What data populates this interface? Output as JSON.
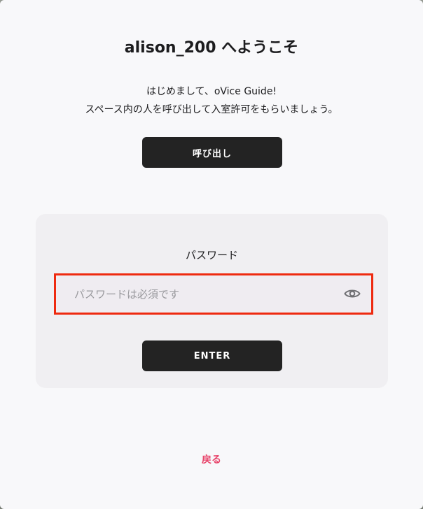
{
  "dialog": {
    "title": "alison_200 へようこそ",
    "description_line1": "はじめまして、oVice Guide!",
    "description_line2": "スペース内の人を呼び出して入室許可をもらいましょう。",
    "call_button_label": "呼び出し"
  },
  "password": {
    "label": "パスワード",
    "value": "",
    "placeholder": "パスワードは必須です",
    "toggle_icon": "eye-icon",
    "enter_button_label": "ENTER"
  },
  "back_link_label": "戻る",
  "colors": {
    "button_bg": "#232323",
    "back_link": "#e8456b",
    "highlight": "#ee2a10",
    "modal_bg": "#f8f8fa",
    "panel_bg": "#f0eff2"
  }
}
